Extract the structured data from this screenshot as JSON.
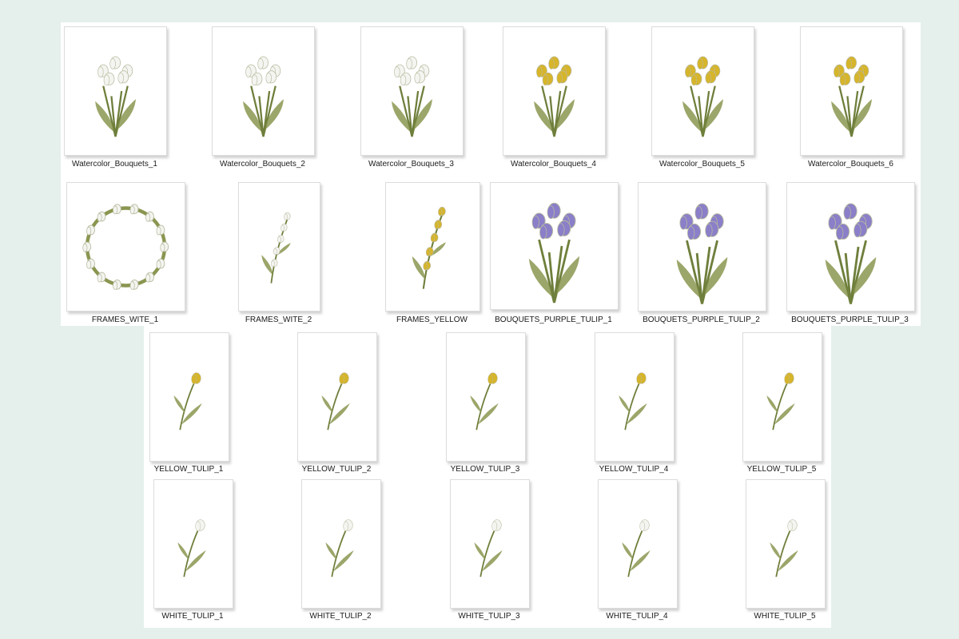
{
  "colors": {
    "background": "#e5f0ed",
    "panel": "#ffffff",
    "stem": "#6f7f3c",
    "leaf": "#8a9650",
    "white_flower": "#f4f4f0",
    "yellow_flower": "#d6b52b",
    "purple_flower": "#8a7fc8"
  },
  "rows": [
    {
      "items": [
        {
          "label": "Watercolor_Bouquets_1",
          "icon": "white-tulip-bouquet-icon"
        },
        {
          "label": "Watercolor_Bouquets_2",
          "icon": "white-tulip-bouquet-icon"
        },
        {
          "label": "Watercolor_Bouquets_3",
          "icon": "white-tulip-bouquet-icon"
        },
        {
          "label": "Watercolor_Bouquets_4",
          "icon": "yellow-tulip-bouquet-icon"
        },
        {
          "label": "Watercolor_Bouquets_5",
          "icon": "yellow-tulip-bouquet-icon"
        },
        {
          "label": "Watercolor_Bouquets_6",
          "icon": "yellow-tulip-bouquet-icon"
        }
      ]
    },
    {
      "items": [
        {
          "label": "FRAMES_WITE_1",
          "icon": "white-tulip-wreath-icon"
        },
        {
          "label": "FRAMES_WITE_2",
          "icon": "white-tulip-branch-icon"
        },
        {
          "label": "FRAMES_YELLOW",
          "icon": "yellow-tulip-branch-icon"
        },
        {
          "label": "BOUQUETS_PURPLE_TULIP_1",
          "icon": "purple-tulip-bouquet-icon"
        },
        {
          "label": "BOUQUETS_PURPLE_TULIP_2",
          "icon": "purple-tulip-bouquet-icon"
        },
        {
          "label": "BOUQUETS_PURPLE_TULIP_3",
          "icon": "purple-tulip-bouquet-icon"
        }
      ]
    },
    {
      "items": [
        {
          "label": "YELLOW_TULIP_1",
          "icon": "yellow-tulip-icon"
        },
        {
          "label": "YELLOW_TULIP_2",
          "icon": "yellow-tulip-icon"
        },
        {
          "label": "YELLOW_TULIP_3",
          "icon": "yellow-tulip-icon"
        },
        {
          "label": "YELLOW_TULIP_4",
          "icon": "yellow-tulip-icon"
        },
        {
          "label": "YELLOW_TULIP_5",
          "icon": "yellow-tulip-icon"
        }
      ]
    },
    {
      "items": [
        {
          "label": "WHITE_TULIP_1",
          "icon": "white-tulip-icon"
        },
        {
          "label": "WHITE_TULIP_2",
          "icon": "white-tulip-icon"
        },
        {
          "label": "WHITE_TULIP_3",
          "icon": "white-tulip-icon"
        },
        {
          "label": "WHITE_TULIP_4",
          "icon": "white-tulip-icon"
        },
        {
          "label": "WHITE_TULIP_5",
          "icon": "white-tulip-icon"
        }
      ]
    }
  ]
}
